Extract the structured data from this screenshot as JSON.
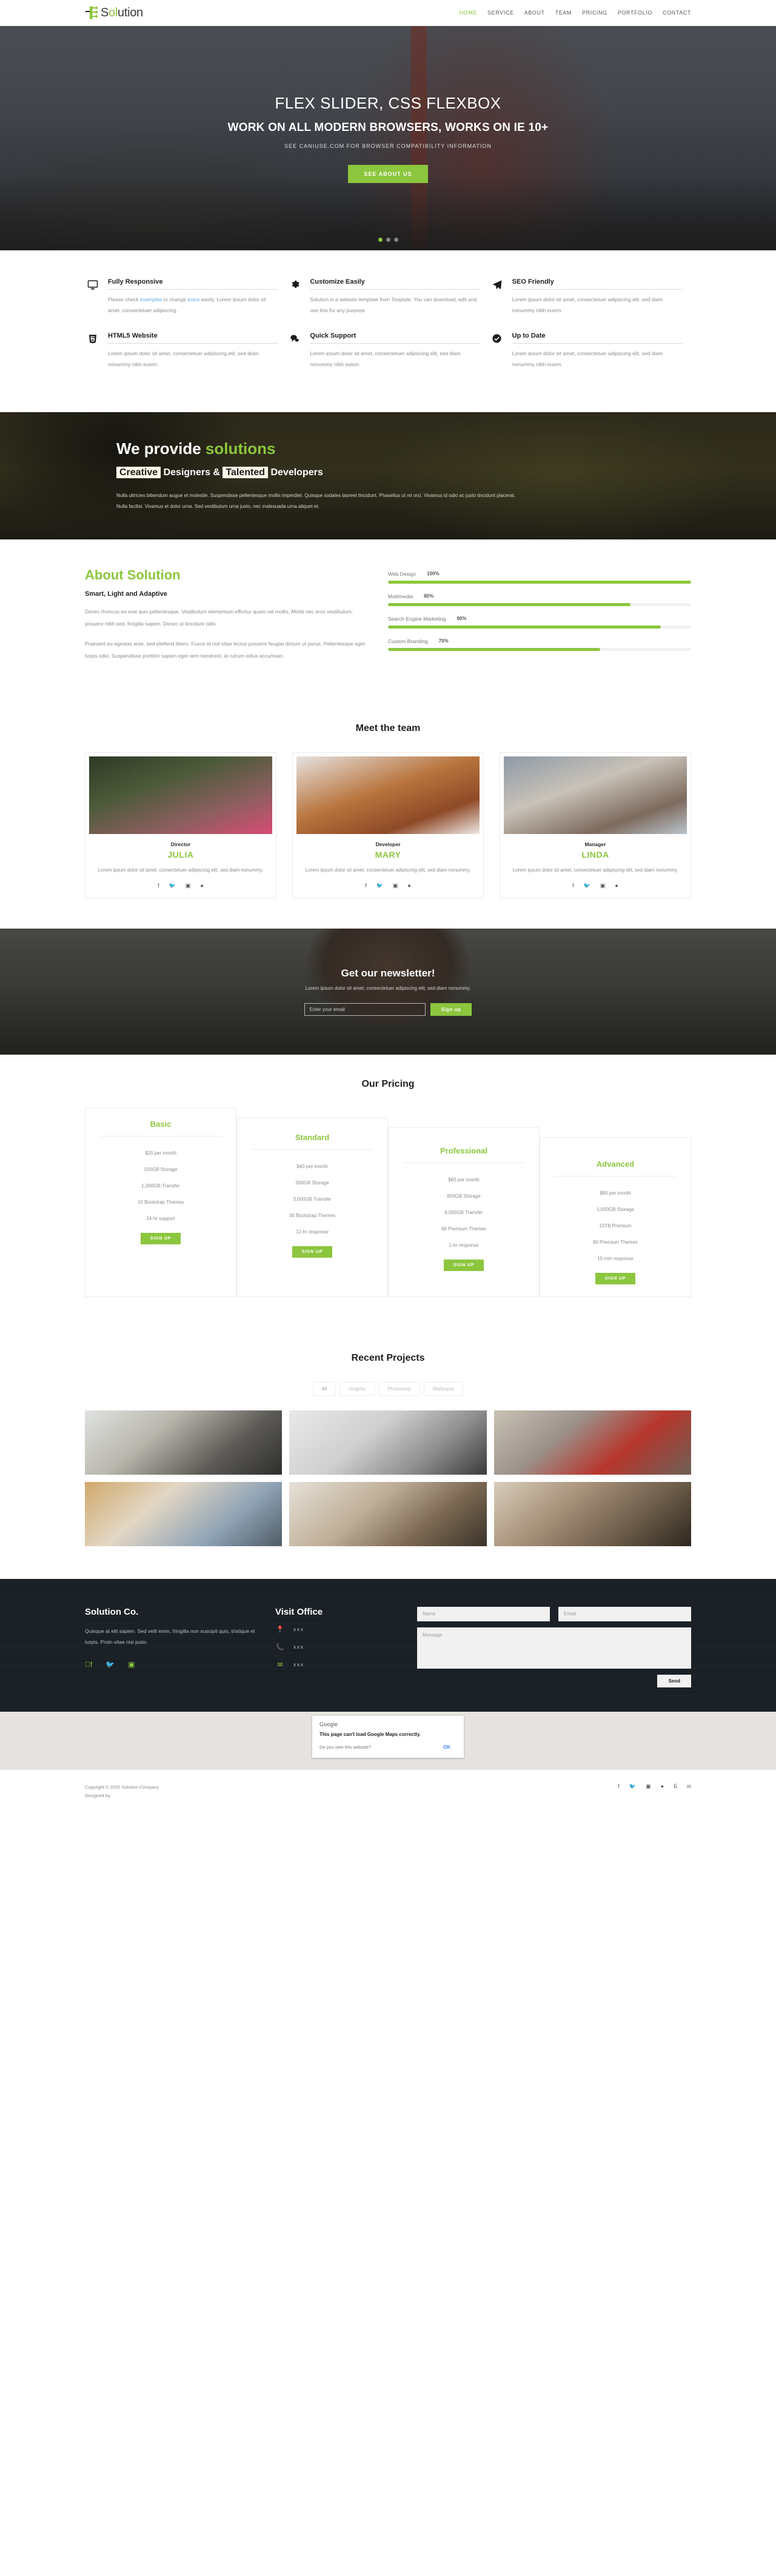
{
  "brand": {
    "name_dark": "S",
    "name_mid": "ol",
    "name_rest": "ution",
    "full": "Solution",
    "accent": "#8cc63e"
  },
  "nav": {
    "items": [
      {
        "label": "HOME",
        "active": true
      },
      {
        "label": "SERVICE",
        "active": false
      },
      {
        "label": "ABOUT",
        "active": false
      },
      {
        "label": "TEAM",
        "active": false
      },
      {
        "label": "PRICING",
        "active": false
      },
      {
        "label": "PORTFOLIO",
        "active": false
      },
      {
        "label": "CONTACT",
        "active": false
      }
    ]
  },
  "hero": {
    "title": "FLEX SLIDER, CSS FLEXBOX",
    "subtitle": "WORK ON ALL MODERN BROWSERS, WORKS ON IE 10+",
    "note": "SEE CANIUSE.COM FOR BROWSER COMPATIBILITY INFORMATION",
    "cta": "SEE ABOUT US"
  },
  "features": {
    "items": [
      {
        "icon": "monitor-icon",
        "title": "Fully Responsive",
        "text_a": "Please check ",
        "link_a": "examples",
        "text_b": " to change ",
        "link_b": "icons",
        "text_c": " easily. Lorem ipsum dolor sit amet, consectetuer adipiscing."
      },
      {
        "icon": "gear-icon",
        "title": "Customize Easily",
        "text_a": "Solution is a website template from Tooplate. You can download, edit and use this for any purpose",
        "link_a": "",
        "text_b": "",
        "link_b": "",
        "text_c": ""
      },
      {
        "icon": "paper-plane-icon",
        "title": "SEO Friendly",
        "text_a": "Lorem ipsum dolor sit amet, consectetuer adipiscing elit, sed diam nonummy nibh euism.",
        "link_a": "",
        "text_b": "",
        "link_b": "",
        "text_c": ""
      },
      {
        "icon": "html5-icon",
        "title": "HTML5 Website",
        "text_a": "Lorem ipsum dolor sit amet, consectetuer adipiscing elit, sed diam nonummy nibh euism.",
        "link_a": "",
        "text_b": "",
        "link_b": "",
        "text_c": ""
      },
      {
        "icon": "chat-bubble-icon",
        "title": "Quick Support",
        "text_a": "Lorem ipsum dolor sit amet, consectetuer adipiscing elit, sed diam nonummy nibh euism.",
        "link_a": "",
        "text_b": "",
        "link_b": "",
        "text_c": ""
      },
      {
        "icon": "check-circle-icon",
        "title": "Up to Date",
        "text_a": "Lorem ipsum dolor sit amet, consectetuer adipiscing elit, sed diam nonummy nibh euism.",
        "link_a": "",
        "text_b": "",
        "link_b": "",
        "text_c": ""
      }
    ]
  },
  "solutions": {
    "title_white": "We provide ",
    "title_green": "solutions",
    "hl1": "Creative",
    "mid1": " Designers & ",
    "hl2": "Talented",
    "mid2": " Developers",
    "paragraph": "Nulla ultricies bibendum augue et molestie. Suspendisse pellentesque mollis imperdiet. Quisque sodales laoreet tincidunt. Phasellus ut mi orci. Vivamus id odio ac justo tincidunt placerat. Nulla facilisi. Vivamus et dolor urna. Sed vestibulum urna justo, nec malesuada urna aliquet et."
  },
  "about": {
    "title": "About Solution",
    "subtitle": "Smart, Light and Adaptive",
    "p1": "Donec rhoncus eu erat quis pellentesque. Vestibulum elementum efficitur quam vel mollis. Morbi nec eros vestibulum, posuere nibh sed, fringilla sapien. Donec ut tincidunt odio.",
    "p2": "Praesent eu egestas ante, sed eleifend libero. Fusce id nisl vitae lectus posuere feugiat dictum ut purus. Pellentesque eget turpis odio. Suspendisse porttitor sapien eget sem hendrerit, at rutrum tellus accumsan.",
    "skills": [
      {
        "name": "Web Design",
        "pct": "100%",
        "value": 100
      },
      {
        "name": "Multimedia",
        "pct": "80%",
        "value": 80
      },
      {
        "name": "Search Engine Marketing",
        "pct": "90%",
        "value": 90
      },
      {
        "name": "Custom Branding",
        "pct": "70%",
        "value": 70
      }
    ]
  },
  "team": {
    "title": "Meet the team",
    "members": [
      {
        "role": "Director",
        "name": "JULIA",
        "desc": "Lorem ipsum dolor sit amet, consectetuer adipiscing elit, sed diam nonummy."
      },
      {
        "role": "Developer",
        "name": "MARY",
        "desc": "Lorem ipsum dolor sit amet, consectetuer adipiscing elit, sed diam nonummy."
      },
      {
        "role": "Manager",
        "name": "LINDA",
        "desc": "Lorem ipsum dolor sit amet, consectetuer adipiscing elit, sed diam nonummy."
      }
    ],
    "social": [
      "facebook-icon",
      "twitter-icon",
      "instagram-icon",
      "dribbble-icon"
    ]
  },
  "newsletter": {
    "title": "Get our newsletter!",
    "subtitle": "Lorem ipsum dolor sit amet, consectetuer adipiscing elit, sed diam nonummy.",
    "placeholder": "Enter your email",
    "button": "Sign up"
  },
  "pricing": {
    "title": "Our Pricing",
    "plans": [
      {
        "name": "Basic",
        "features": [
          "$20 per month",
          "100GB Storage",
          "1,000GB Transfer",
          "10 Bootstrap Themes",
          "24-hr support"
        ],
        "cta": "SIGN UP"
      },
      {
        "name": "Standard",
        "features": [
          "$40 per month",
          "300GB Storage",
          "3,000GB Transfer",
          "30 Bootstrap Themes",
          "12-hr response"
        ],
        "cta": "SIGN UP"
      },
      {
        "name": "Professional",
        "features": [
          "$60 per month",
          "600GB Storage",
          "6,000GB Transfer",
          "60 Premium Themes",
          "1-hr response"
        ],
        "cta": "SIGN UP"
      },
      {
        "name": "Advanced",
        "features": [
          "$80 per month",
          "1,000GB Storage",
          "10TB Premium",
          "80 Premium Themes",
          "15-min response"
        ],
        "cta": "SIGN UP"
      }
    ]
  },
  "projects": {
    "title": "Recent Projects",
    "filters": [
      {
        "label": "All",
        "active": true
      },
      {
        "label": "Graphic",
        "active": false
      },
      {
        "label": "Photoshop",
        "active": false
      },
      {
        "label": "Wallpaper",
        "active": false
      }
    ],
    "items": [
      {
        "name": "project-camera-desk"
      },
      {
        "name": "project-laptop-dark"
      },
      {
        "name": "project-street-tram"
      },
      {
        "name": "project-macbook-beach"
      },
      {
        "name": "project-interior-table"
      },
      {
        "name": "project-desk-flatlay"
      }
    ]
  },
  "contact": {
    "company_title": "Solution Co.",
    "company_text": "Quisque at elit sapien. Sed velit enim, fringilla non suscipit quis, tristique et turpis. Proin vitae nisi justo.",
    "social": [
      "facebook-icon",
      "twitter-icon",
      "instagram-icon"
    ],
    "office_title": "Visit Office",
    "rows": [
      {
        "icon": "map-pin-icon",
        "value": "xxx"
      },
      {
        "icon": "phone-icon",
        "value": "xxx"
      },
      {
        "icon": "envelope-icon",
        "value": "xxx"
      }
    ],
    "form": {
      "name_placeholder": "Name",
      "email_placeholder": "Email",
      "message_placeholder": "Message",
      "send_label": "Send"
    }
  },
  "map": {
    "dialog": {
      "logo": "Google",
      "message": "This page can't load Google Maps correctly.",
      "question": "Do you own this website?",
      "ok": "OK"
    }
  },
  "footer": {
    "copyright": "Copyright © 2020 Solution Company",
    "designer": "Designed by",
    "social": [
      "facebook-icon",
      "twitter-icon",
      "instagram-icon",
      "dribbble-icon",
      "behance-icon",
      "linkedin-icon"
    ]
  }
}
